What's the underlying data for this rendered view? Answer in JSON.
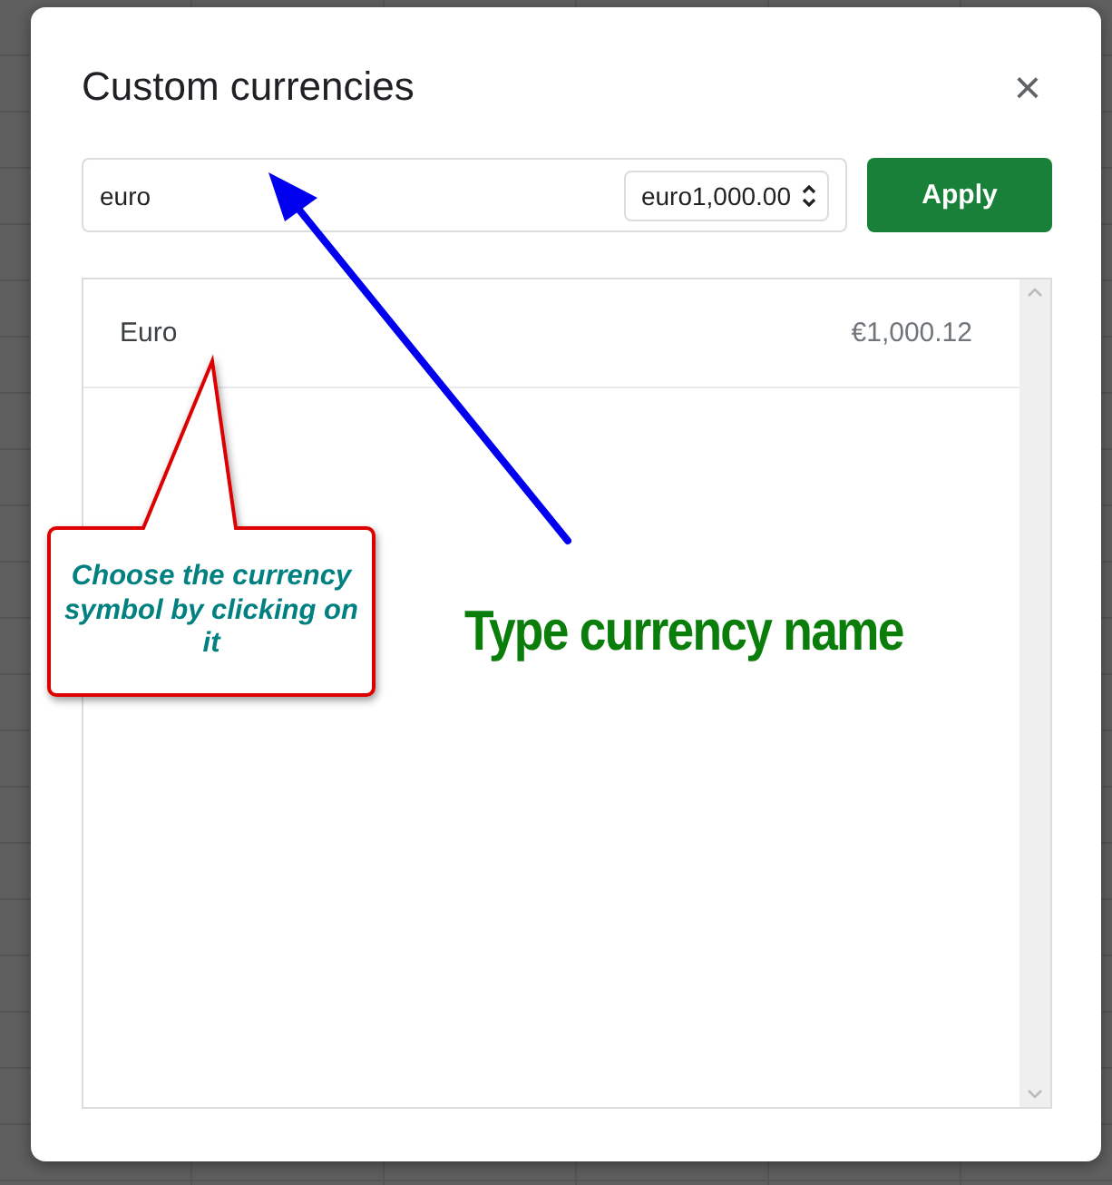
{
  "dialog": {
    "title": "Custom currencies",
    "close_icon": "×"
  },
  "search": {
    "value": "euro"
  },
  "format_select": {
    "value": "euro1,000.00"
  },
  "apply_button": "Apply",
  "currencies": [
    {
      "name": "Euro",
      "example": "€1,000.12"
    }
  ],
  "annotations": {
    "callout": "Choose the currency symbol by clicking on it",
    "arrow_label": "Type currency name"
  }
}
